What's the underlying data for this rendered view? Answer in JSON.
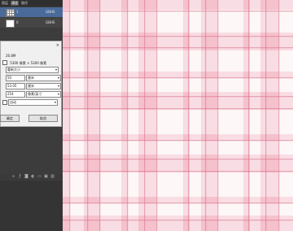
{
  "layers_panel": {
    "tabs": [
      "图层",
      "通道",
      "路径"
    ],
    "active_tab": 1,
    "layers": [
      {
        "name": "1",
        "extra": "GBHS"
      },
      {
        "name": "0",
        "extra": "GBHS"
      }
    ]
  },
  "dialog": {
    "size_text": "26.8M",
    "dimension_text": "5300 像素 × 5300 像素",
    "resample_label": "重新大小",
    "width_value": "50",
    "width_unit": "厘米",
    "height_value": "53.05",
    "height_unit": "厘米",
    "resolution_value": "254",
    "resolution_unit": "像素/英寸",
    "method": "自动",
    "ok_label": "确定",
    "cancel_label": "取消"
  },
  "toolbar_icons": [
    "link-icon",
    "fx-icon",
    "mask-icon",
    "adjust-icon",
    "folder-icon",
    "new-layer-icon",
    "trash-icon"
  ],
  "canvas": {
    "pattern": "pink plaid / gingham watercolor",
    "colors": {
      "base": "#fdf7f8",
      "light_band": "#f6c9d3",
      "mid_band": "#f1aebb",
      "line": "#d9778d"
    }
  }
}
